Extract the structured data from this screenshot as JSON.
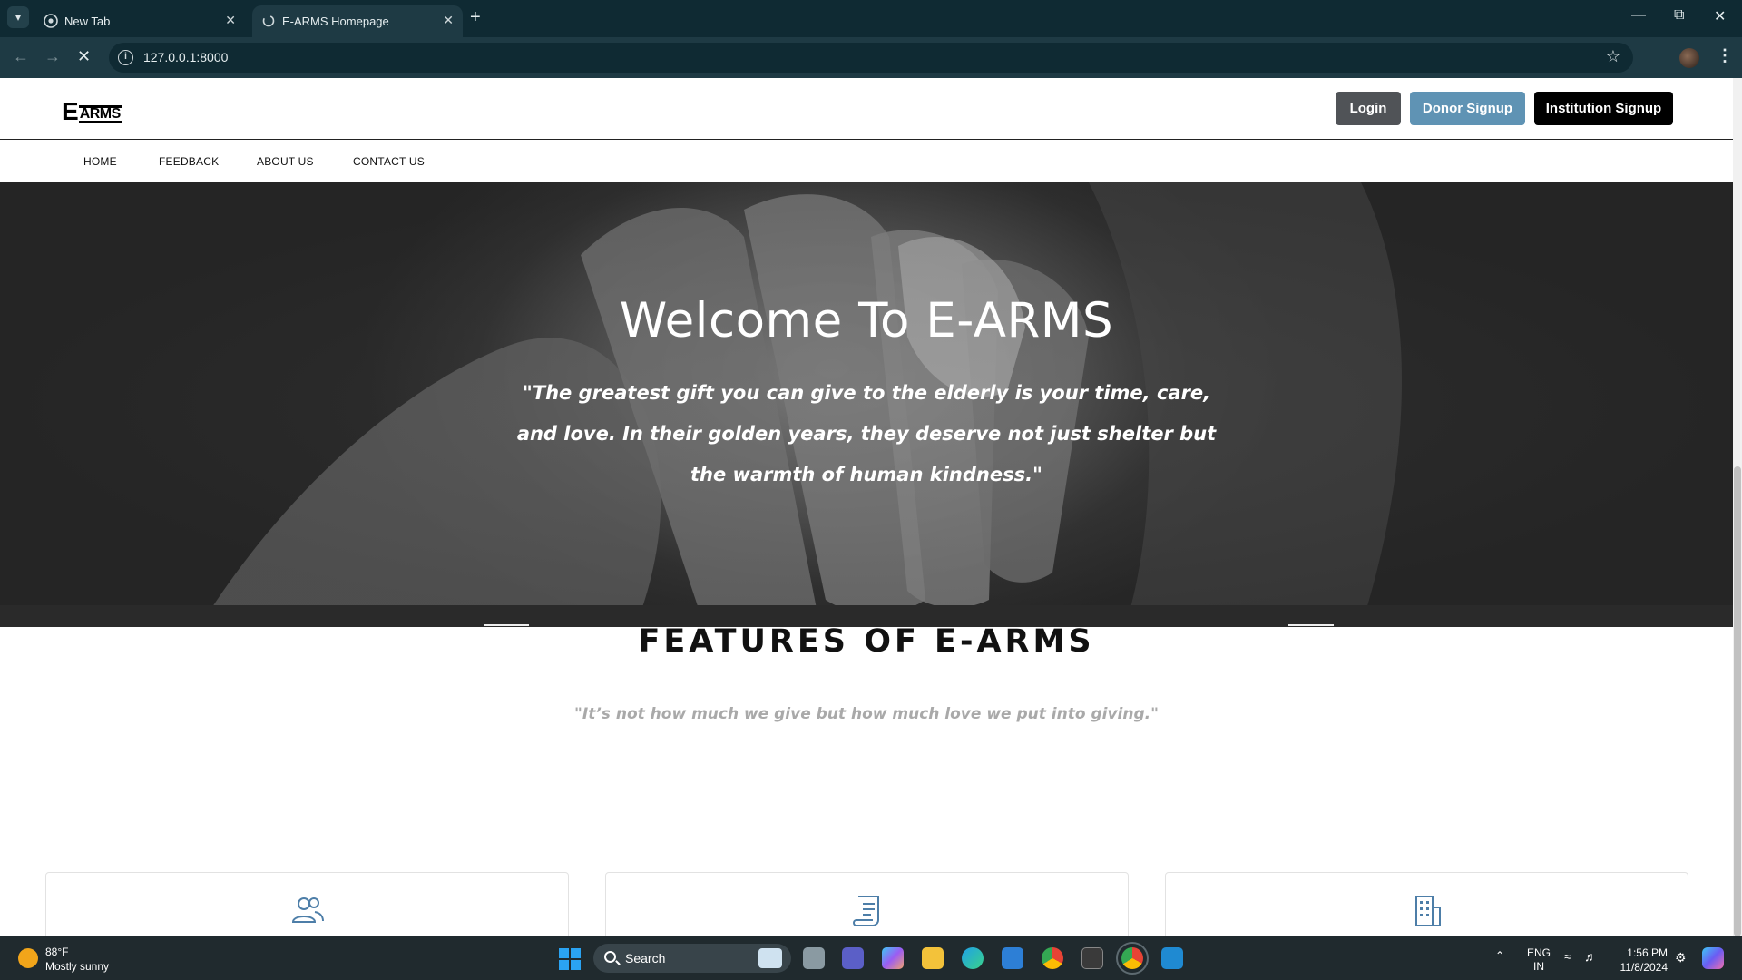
{
  "browser": {
    "tabs": [
      {
        "title": "New Tab"
      },
      {
        "title": "E-ARMS Homepage"
      }
    ],
    "url": "127.0.0.1:8000"
  },
  "site": {
    "logo": {
      "big": "E",
      "small": "ARMS"
    },
    "buttons": {
      "login": "Login",
      "donor_signup": "Donor Signup",
      "institution_signup": "Institution Signup"
    },
    "menu": [
      {
        "label": "HOME"
      },
      {
        "label": "FEEDBACK"
      },
      {
        "label": "ABOUT US"
      },
      {
        "label": "CONTACT US"
      }
    ],
    "hero": {
      "title": "Welcome To E-ARMS",
      "quote": "\"The greatest gift you can give to the elderly is your time, care, and love. In their golden years, they deserve not just shelter but the warmth of human kindness.\""
    },
    "features": {
      "title": "FEATURES OF E-ARMS",
      "subtitle": "\"It’s not how much we give but how much love we put into giving.\"",
      "cards": [
        {
          "icon": "users-icon"
        },
        {
          "icon": "scroll-icon"
        },
        {
          "icon": "building-icon"
        }
      ]
    }
  },
  "taskbar": {
    "weather_temp": "88°F",
    "weather_cond": "Mostly sunny",
    "search_placeholder": "Search",
    "lang_line1": "ENG",
    "lang_line2": "IN",
    "time": "1:56 PM",
    "date": "11/8/2024"
  },
  "colors": {
    "chrome_dark": "#0f2a33",
    "chrome_bar": "#1e3a44",
    "login_bg": "#505357",
    "donor_bg": "#5f93b4",
    "institution_bg": "#000000",
    "icon_blue": "#4d7ea8"
  }
}
